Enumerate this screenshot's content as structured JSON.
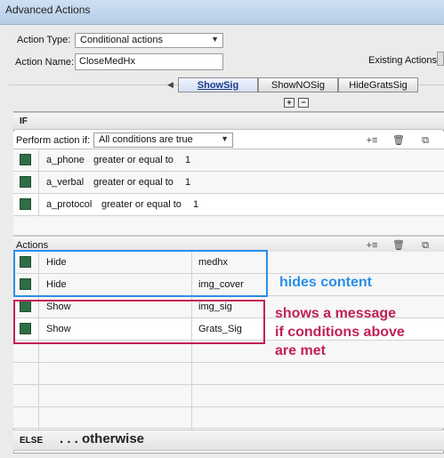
{
  "window": {
    "title": "Advanced Actions"
  },
  "form": {
    "action_type_label": "Action Type:",
    "action_type_value": "Conditional actions",
    "action_name_label": "Action Name:",
    "action_name_value": "CloseMedHx",
    "existing_actions_label": "Existing Actions:"
  },
  "tabs": [
    {
      "label": "ShowSig",
      "active": true
    },
    {
      "label": "ShowNOSig",
      "active": false
    },
    {
      "label": "HideGratsSig",
      "active": false
    }
  ],
  "if_section": {
    "title": "IF",
    "perform_label": "Perform action if:",
    "perform_value": "All conditions are true",
    "conditions": [
      {
        "variable": "a_phone",
        "operator": "greater or equal to",
        "value": "1"
      },
      {
        "variable": "a_verbal",
        "operator": "greater or equal to",
        "value": "1"
      },
      {
        "variable": "a_protocol",
        "operator": "greater or equal to",
        "value": "1"
      }
    ]
  },
  "actions_section": {
    "title": "Actions",
    "rows": [
      {
        "action": "Hide",
        "target": "medhx"
      },
      {
        "action": "Hide",
        "target": "img_cover"
      },
      {
        "action": "Show",
        "target": "img_sig"
      },
      {
        "action": "Show",
        "target": "Grats_Sig"
      }
    ]
  },
  "else_section": {
    "title": "ELSE"
  },
  "annotations": {
    "blue": "hides content",
    "red_line1": "shows a message",
    "red_line2": "if conditions above",
    "red_line3": "are met",
    "black": ". . . otherwise"
  },
  "colors": {
    "blue_annotation": "#2a8ee8",
    "red_annotation": "#c0205a",
    "check_square": "#2f6e45"
  }
}
